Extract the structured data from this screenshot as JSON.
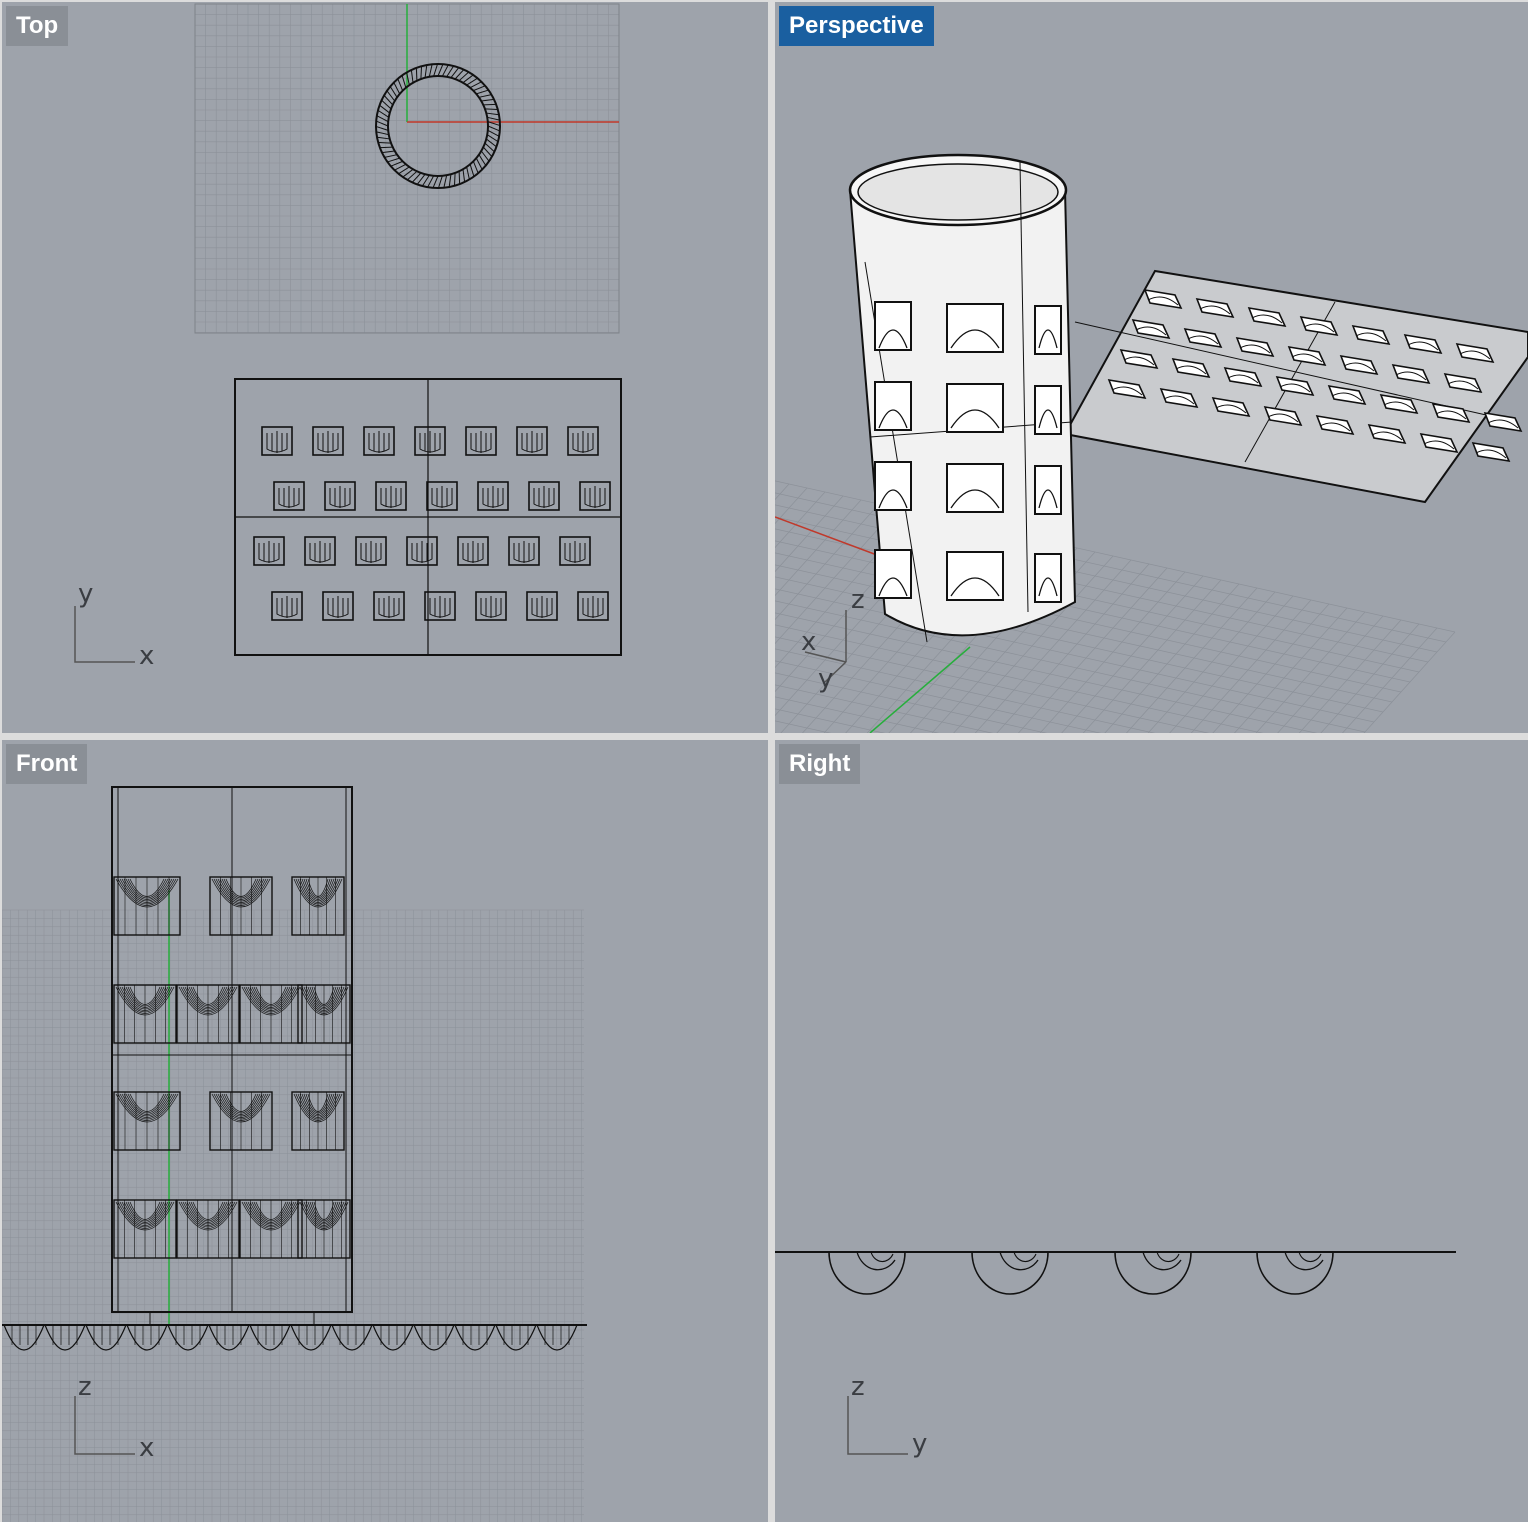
{
  "viewports": {
    "top": {
      "label": "Top",
      "active": false,
      "axis_v": "y",
      "axis_h": "x"
    },
    "perspective": {
      "label": "Perspective",
      "active": true,
      "axis_z": "z",
      "axis_x": "x",
      "axis_y": "y"
    },
    "front": {
      "label": "Front",
      "active": false,
      "axis_v": "z",
      "axis_h": "x"
    },
    "right": {
      "label": "Right",
      "active": false,
      "axis_v": "z",
      "axis_h": "y"
    }
  },
  "colors": {
    "viewport_bg": "#9ea3ab",
    "grid_line": "#8c9199",
    "active_label_bg": "#1a5fa0",
    "inactive_label_bg": "#8a8f96",
    "x_axis": "#c0392b",
    "y_axis": "#27ae3c",
    "geometry": "#111111",
    "surface": "#f2f2f2"
  }
}
